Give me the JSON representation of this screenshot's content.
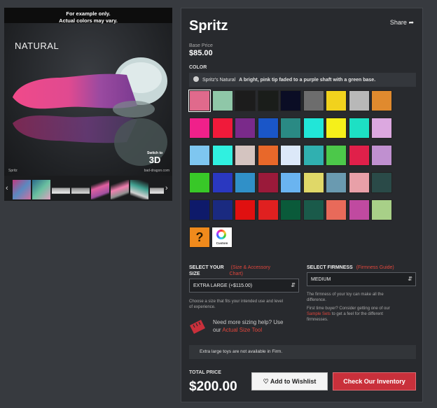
{
  "gallery": {
    "notice_line1": "For example only.",
    "notice_line2": "Actual colors may vary.",
    "image_label": "NATURAL",
    "image_caption": "Spritz",
    "image_site": "bad-dragon.com",
    "switch_small": "Switch to",
    "switch_big": "3D",
    "prev_arrow": "‹",
    "next_arrow": "›"
  },
  "product": {
    "title": "Spritz",
    "share_label": "Share",
    "share_icon": "share-arrow-icon",
    "base_price_label": "Base Price",
    "base_price": "$85.00"
  },
  "color": {
    "section_label": "COLOR",
    "selected_name": "Spritz's Natural",
    "selected_desc": "A bright, pink tip faded to a purple shaft with a green base.",
    "swatches": [
      [
        "#e06a8c",
        "#8fc7a8",
        "#1c1c1c",
        "#1a1d1a",
        "#0b0d25",
        "#6d6d6d",
        "#f1d21d",
        "#b8b8b8",
        "#e08a2e"
      ],
      [
        "#f0208a",
        "#f01a3a",
        "#7a2a8a",
        "#1a56c8",
        "#2a8a84",
        "#21e6d8",
        "#f5f01a",
        "#1de0c4",
        "#dca8e0"
      ],
      [
        "#7ec6f0",
        "#30f0e0",
        "#d4c4c0",
        "#e8682a",
        "#dce8f8",
        "#30b0b0",
        "#4cc84a",
        "#e0204a",
        "#c090d0"
      ],
      [
        "#38c828",
        "#2a38c0",
        "#3090c8",
        "#9a1a3a",
        "#6ab4f0",
        "#e0d868",
        "#6a9ab0",
        "#e8a0a8",
        "#2a4a48"
      ],
      [
        "#0e1a6a",
        "#1a2a80",
        "#e01010",
        "#e02020",
        "#0a5a3a",
        "#1a5a4a",
        "#e86a5a",
        "#c04aa0",
        "#a8d088"
      ]
    ],
    "special_question": "?",
    "custom_label": "Custom"
  },
  "size": {
    "label_line1": "SELECT YOUR",
    "label_line2": "SIZE",
    "link_text_line1": "(Size & Accessory",
    "link_text_line2": "Chart)",
    "selected": "EXTRA LARGE (+$115.00)",
    "help_line1": "Choose a size that fits your intended use and level",
    "help_line2": "of experience."
  },
  "firmness": {
    "label": "SELECT FIRMNESS",
    "link_text": "(Firmness Guide)",
    "selected": "MEDIUM",
    "help_line1": "The firmness of your toy can make all the",
    "help_line2": "difference.",
    "help_line3": "First time buyer? Consider getting one of our",
    "help_link": "Sample Sets",
    "help_line4_rest": " to get a feel for the different",
    "help_line5": "firmnesses."
  },
  "sizing_help": {
    "line1": "Need more sizing help? Use",
    "line2_prefix": "our ",
    "link": "Actual Size Tool"
  },
  "warning": "Extra large toys are not available in Firm.",
  "total": {
    "label": "TOTAL PRICE",
    "value": "$200.00"
  },
  "buttons": {
    "wishlist": "Add to Wishlist",
    "inventory": "Check Our Inventory"
  }
}
